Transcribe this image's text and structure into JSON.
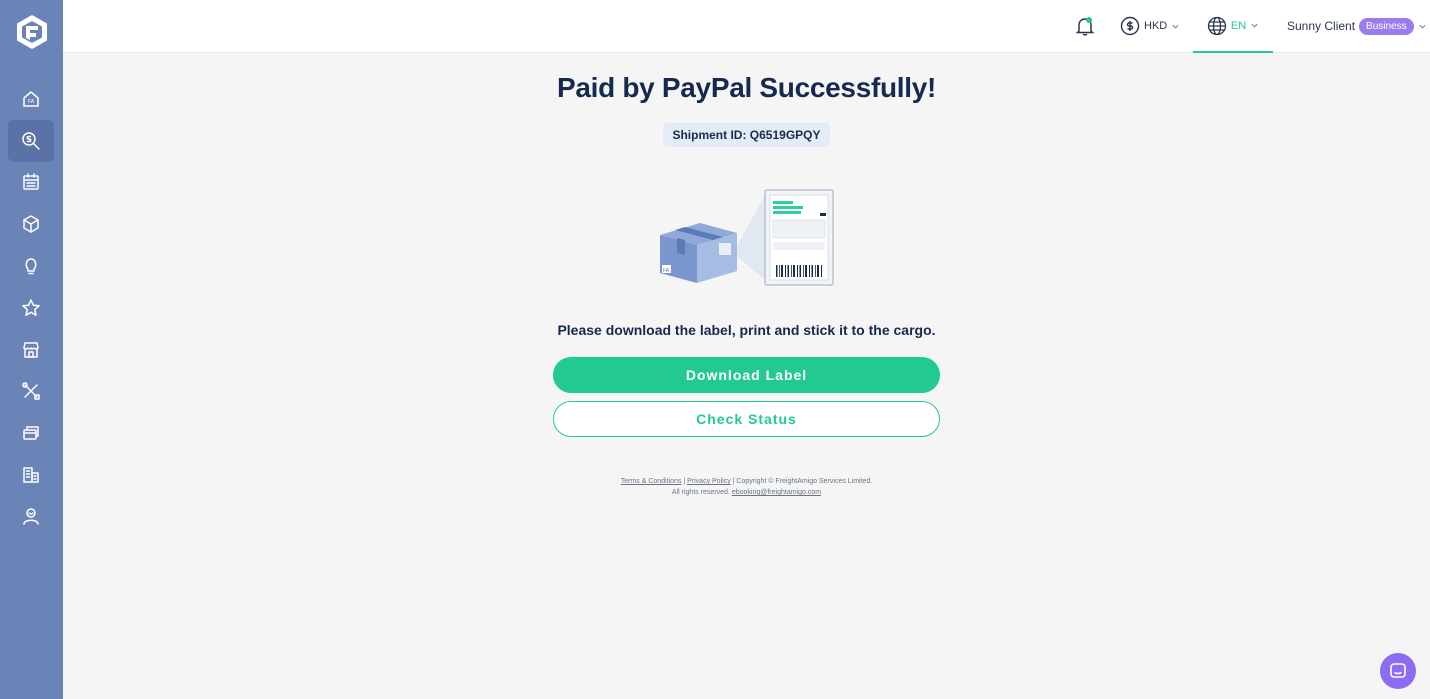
{
  "header": {
    "currency": "HKD",
    "language": "EN",
    "user_name": "Sunny Client",
    "user_badge": "Business"
  },
  "sidebar": {
    "items": [
      {
        "icon": "home-icon"
      },
      {
        "icon": "search-dollar-icon",
        "active": true
      },
      {
        "icon": "calendar-icon"
      },
      {
        "icon": "package-icon"
      },
      {
        "icon": "lightbulb-icon"
      },
      {
        "icon": "star-icon"
      },
      {
        "icon": "store-icon"
      },
      {
        "icon": "tools-icon"
      },
      {
        "icon": "cards-icon"
      },
      {
        "icon": "building-icon"
      },
      {
        "icon": "user-icon"
      }
    ]
  },
  "main": {
    "title": "Paid by PayPal Successfully!",
    "shipment_id": "Shipment ID: Q6519GPQY",
    "instruction": "Please download the label, print and stick it to the cargo.",
    "download_button": "Download Label",
    "status_button": "Check Status"
  },
  "footer": {
    "terms": "Terms & Conditions",
    "sep1": " | ",
    "privacy": "Privacy Policy",
    "copyright": " | Copyright © FreightAmigo Services Limited.",
    "rights": "All rights reserved. ",
    "email": "ebooking@freightamigo.com"
  },
  "colors": {
    "sidebar": "#6b84b8",
    "accent": "#22c993",
    "badge": "#9b7cf0",
    "title": "#16294f"
  }
}
